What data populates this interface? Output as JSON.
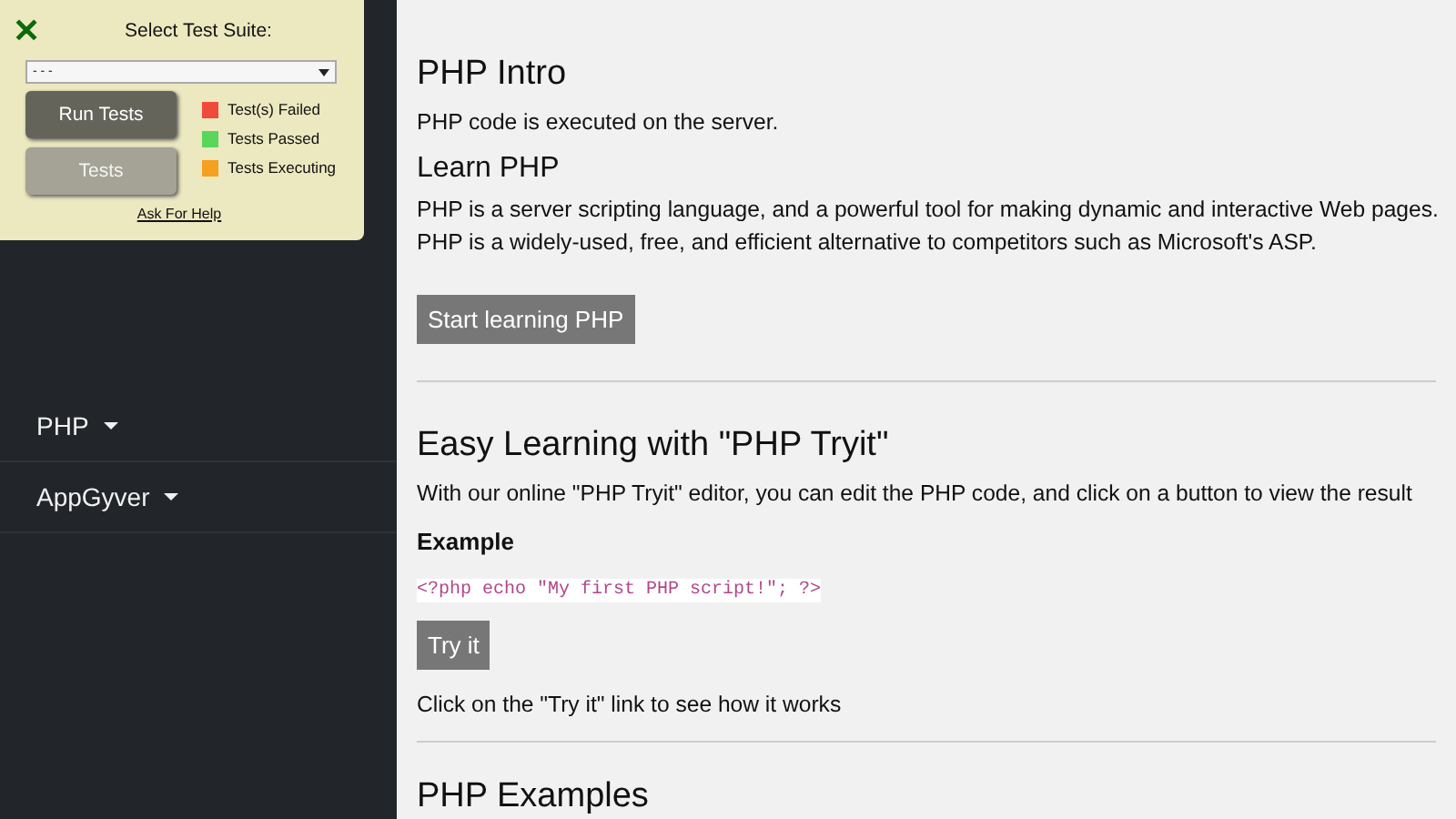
{
  "test_panel": {
    "close_icon": "✕",
    "title": "Select Test Suite:",
    "suite_select": {
      "value": "- - -"
    },
    "buttons": [
      {
        "label": "Run Tests",
        "kind": "primary"
      },
      {
        "label": "Tests",
        "kind": "secondary"
      }
    ],
    "legend": [
      {
        "label": "Test(s) Failed",
        "color": "#f04a3a"
      },
      {
        "label": "Tests Passed",
        "color": "#5ad65a"
      },
      {
        "label": "Tests Executing",
        "color": "#f5a01e"
      }
    ],
    "help_link": "Ask For Help"
  },
  "sidebar": {
    "items": [
      {
        "label": "PHP"
      },
      {
        "label": "AppGyver"
      }
    ]
  },
  "content": {
    "sections": [
      {
        "kind": "intro",
        "title": "PHP Intro",
        "text": "PHP code is executed on the server.",
        "subtitle": "Learn PHP",
        "paragraphs": [
          "PHP is a server scripting language, and a powerful tool for making dynamic and interactive Web pages.",
          "PHP is a widely-used, free, and efficient alternative to competitors such as Microsoft's ASP."
        ],
        "button": "Start learning PHP"
      },
      {
        "kind": "example",
        "title": "Easy Learning with \"PHP Tryit\"",
        "text": "With our online \"PHP Tryit\" editor, you can edit the PHP code, and click on a button to view the result",
        "label": "Example",
        "code": "<?php echo \"My first PHP script!\"; ?>",
        "button": "Try it",
        "note": "Click on the \"Try it\" link to see how it works"
      },
      {
        "kind": "heading",
        "title": "PHP Examples"
      }
    ]
  }
}
